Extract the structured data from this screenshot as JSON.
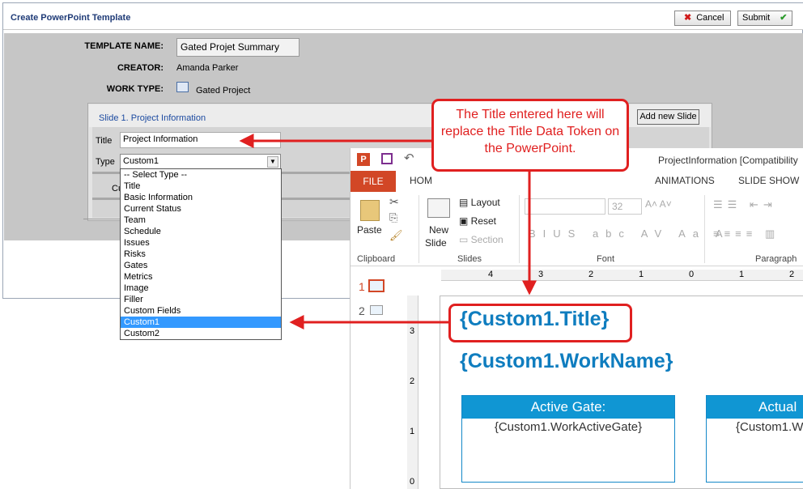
{
  "form": {
    "title": "Create PowerPoint Template",
    "cancel_label": "Cancel",
    "submit_label": "Submit",
    "template_name_label": "TEMPLATE NAME:",
    "template_name_value": "Gated Projet Summary",
    "creator_label": "CREATOR:",
    "creator_value": "Amanda Parker",
    "work_type_label": "WORK TYPE:",
    "work_type_value": "Gated Project",
    "slide_title": "Slide 1. Project Information",
    "add_slide_label": "Add new Slide",
    "title_label": "Title",
    "title_value": "Project Information",
    "type_label": "Type",
    "type_value": "Custom1",
    "partial_label": "Cu"
  },
  "dropdown": {
    "options": [
      "-- Select Type --",
      "Title",
      "Basic Information",
      "Current Status",
      "Team",
      "Schedule",
      "Issues",
      "Risks",
      "Gates",
      "Metrics",
      "Image",
      "Filler",
      "Custom Fields",
      "Custom1",
      "Custom2"
    ],
    "selected_index": 13
  },
  "callout": {
    "text": "The Title entered here will replace the Title Data Token on the PowerPoint."
  },
  "ppt": {
    "window_title": "ProjectInformation [Compatibility",
    "tabs": [
      "FILE",
      "HOM",
      "ANIMATIONS",
      "SLIDE SHOW"
    ],
    "layout_label": "Layout",
    "reset_label": "Reset",
    "section_label": "Section",
    "paste_label": "Paste",
    "new_slide_label_1": "New",
    "new_slide_label_2": "Slide",
    "font_size": "32",
    "group_clipboard": "Clipboard",
    "group_slides": "Slides",
    "group_font": "Font",
    "group_paragraph": "Paragraph",
    "ruler_labels": [
      "4",
      "3",
      "2",
      "1",
      "0",
      "1",
      "2"
    ],
    "vruler_labels": [
      "3",
      "2",
      "1",
      "0"
    ],
    "thumb_numbers": [
      "1",
      "2"
    ],
    "token_title": "{Custom1.Title}",
    "token_workname": "{Custom1.WorkName}",
    "gate_head": "Active Gate:",
    "gate_value": "{Custom1.WorkActiveGate}",
    "actual_head": "Actual",
    "actual_value": "{Custom1.W"
  },
  "colors": {
    "accent_red": "#e02020",
    "token_blue": "#0f7dbf",
    "select_blue": "#3399ff",
    "file_tab": "#d24726"
  }
}
